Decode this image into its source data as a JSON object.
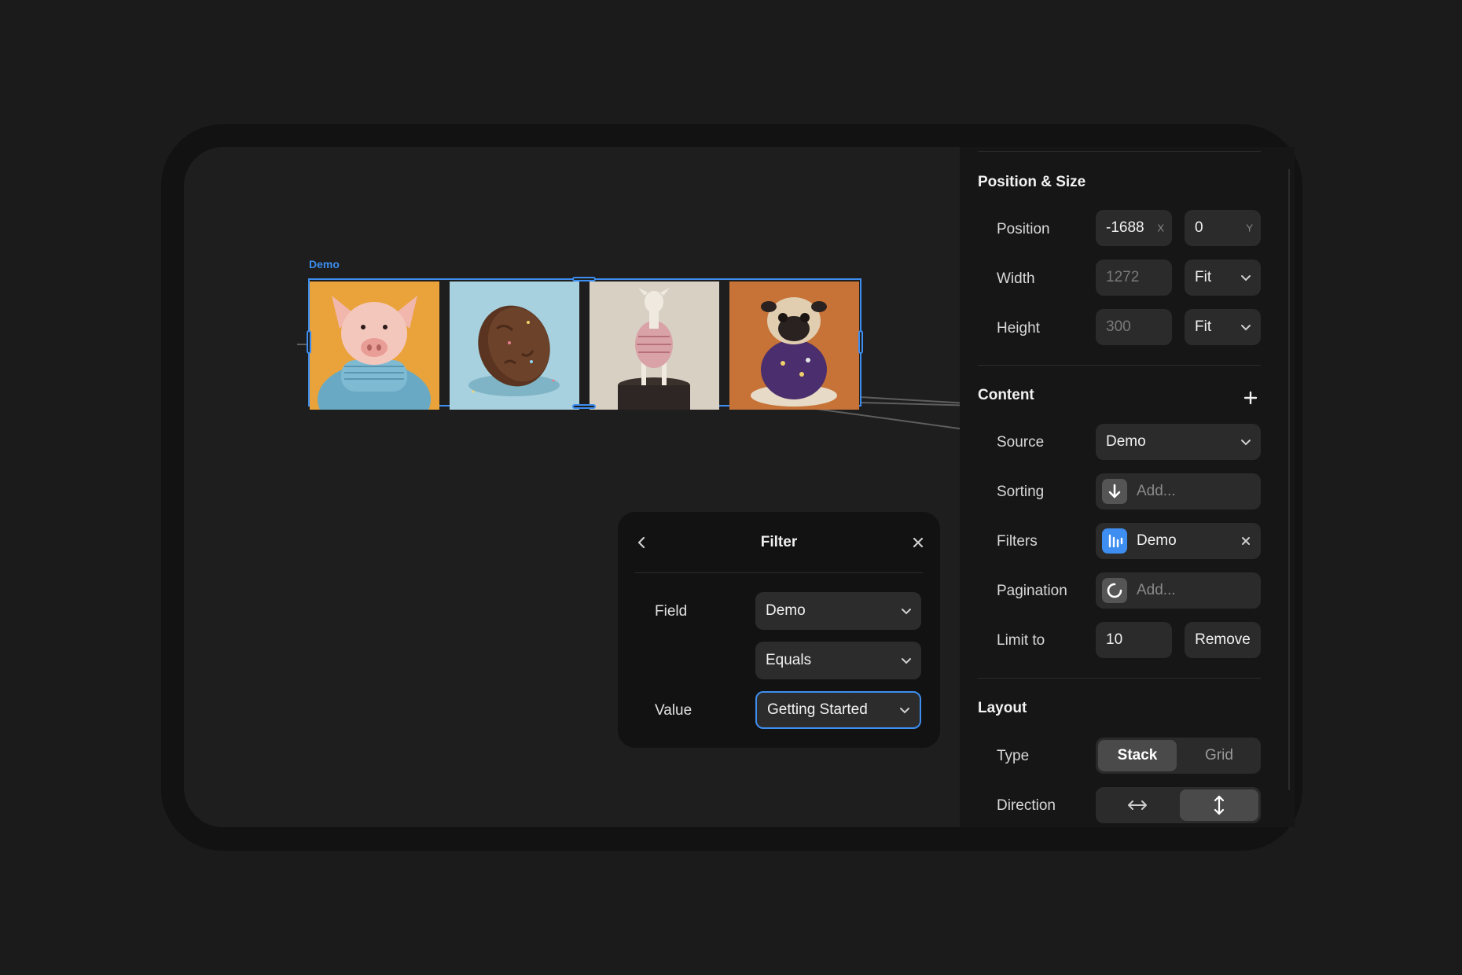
{
  "canvas": {
    "frame_label": "Demo",
    "images": [
      {
        "name": "pig-in-sweater-image"
      },
      {
        "name": "cookie-image"
      },
      {
        "name": "goat-on-pedestal-image"
      },
      {
        "name": "pug-in-shirt-image"
      }
    ]
  },
  "filter_popover": {
    "title": "Filter",
    "field_label": "Field",
    "field_value": "Demo",
    "operator_value": "Equals",
    "value_label": "Value",
    "value_value": "Getting Started"
  },
  "panel": {
    "position_size": {
      "title": "Position & Size",
      "position_label": "Position",
      "x_value": "-1688",
      "x_suffix": "X",
      "y_value": "0",
      "y_suffix": "Y",
      "width_label": "Width",
      "width_value": "1272",
      "width_mode": "Fit",
      "height_label": "Height",
      "height_value": "300",
      "height_mode": "Fit"
    },
    "content": {
      "title": "Content",
      "source_label": "Source",
      "source_value": "Demo",
      "sorting_label": "Sorting",
      "sorting_value": "Add...",
      "filters_label": "Filters",
      "filters_value": "Demo",
      "pagination_label": "Pagination",
      "pagination_value": "Add...",
      "limit_label": "Limit to",
      "limit_value": "10",
      "remove_label": "Remove"
    },
    "layout": {
      "title": "Layout",
      "type_label": "Type",
      "type_options": [
        "Stack",
        "Grid"
      ],
      "type_selected": "Stack",
      "direction_label": "Direction",
      "direction_options": [
        "horizontal-arrows-icon",
        "vertical-arrows-icon"
      ],
      "direction_selected": "vertical"
    }
  },
  "colors": {
    "accent": "#3d8ef0",
    "panel_bg": "#161616",
    "canvas_bg": "#1e1e1e",
    "field_bg": "#2b2b2b"
  }
}
